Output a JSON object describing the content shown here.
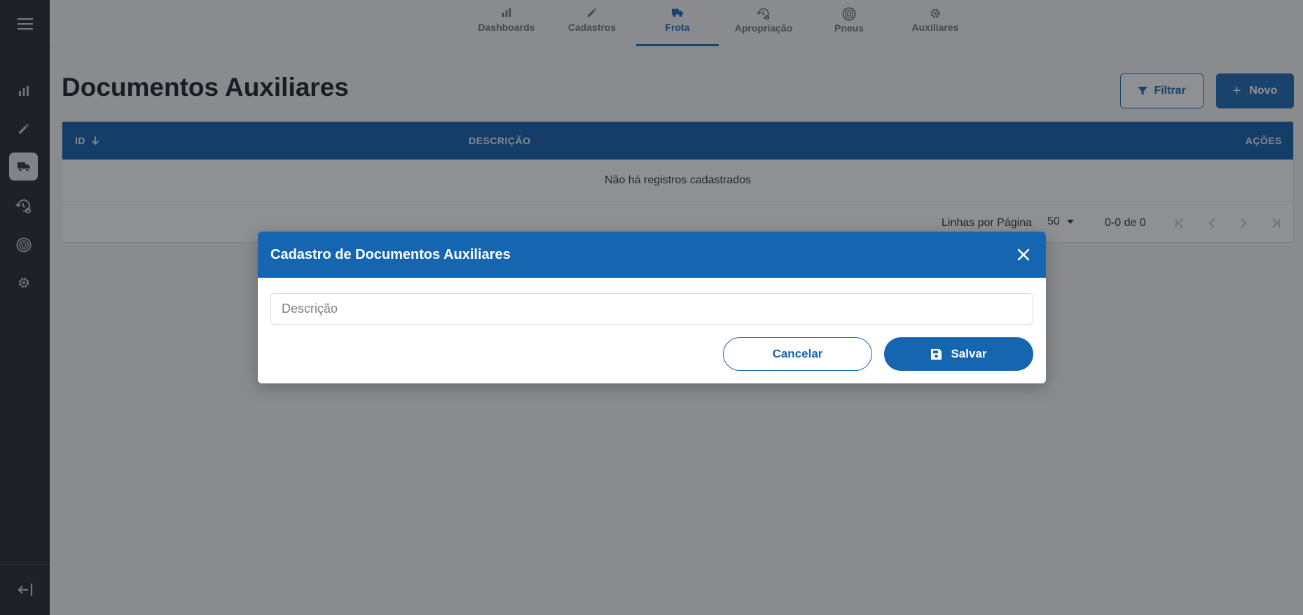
{
  "colors": {
    "primary": "#1565b0",
    "sidebar": "#1f2329",
    "table_header": "#0b5aa6"
  },
  "sidebar": {
    "menu_icon": "hamburger-menu-icon",
    "items": [
      {
        "icon": "bar-chart-icon",
        "name": "Dashboards"
      },
      {
        "icon": "pencil-icon",
        "name": "Cadastros"
      },
      {
        "icon": "truck-icon",
        "name": "Frota",
        "active": true
      },
      {
        "icon": "history-gear-icon",
        "name": "Apropriação"
      },
      {
        "icon": "tire-icon",
        "name": "Pneus"
      },
      {
        "icon": "gear-icon",
        "name": "Auxiliares"
      }
    ],
    "logout_icon": "logout-icon"
  },
  "topnav": {
    "tabs": [
      {
        "label": "Dashboards",
        "icon": "bar-chart-icon"
      },
      {
        "label": "Cadastros",
        "icon": "pencil-icon"
      },
      {
        "label": "Frota",
        "icon": "truck-icon",
        "active": true
      },
      {
        "label": "Apropriação",
        "icon": "history-gear-icon"
      },
      {
        "label": "Pneus",
        "icon": "tire-icon"
      },
      {
        "label": "Auxiliares",
        "icon": "gear-icon"
      }
    ]
  },
  "page": {
    "title": "Documentos Auxiliares",
    "filter_label": "Filtrar",
    "new_label": "Novo"
  },
  "table": {
    "columns": [
      "ID",
      "DESCRIÇÃO",
      "AÇÕES"
    ],
    "empty_message": "Não há registros cadastrados",
    "pagination": {
      "rows_per_page_label": "Linhas por Página",
      "rows_per_page_value": "50",
      "range": "0-0 de 0"
    }
  },
  "modal": {
    "title": "Cadastro de Documentos Auxiliares",
    "description_placeholder": "Descrição",
    "description_value": "",
    "cancel_label": "Cancelar",
    "save_label": "Salvar"
  }
}
